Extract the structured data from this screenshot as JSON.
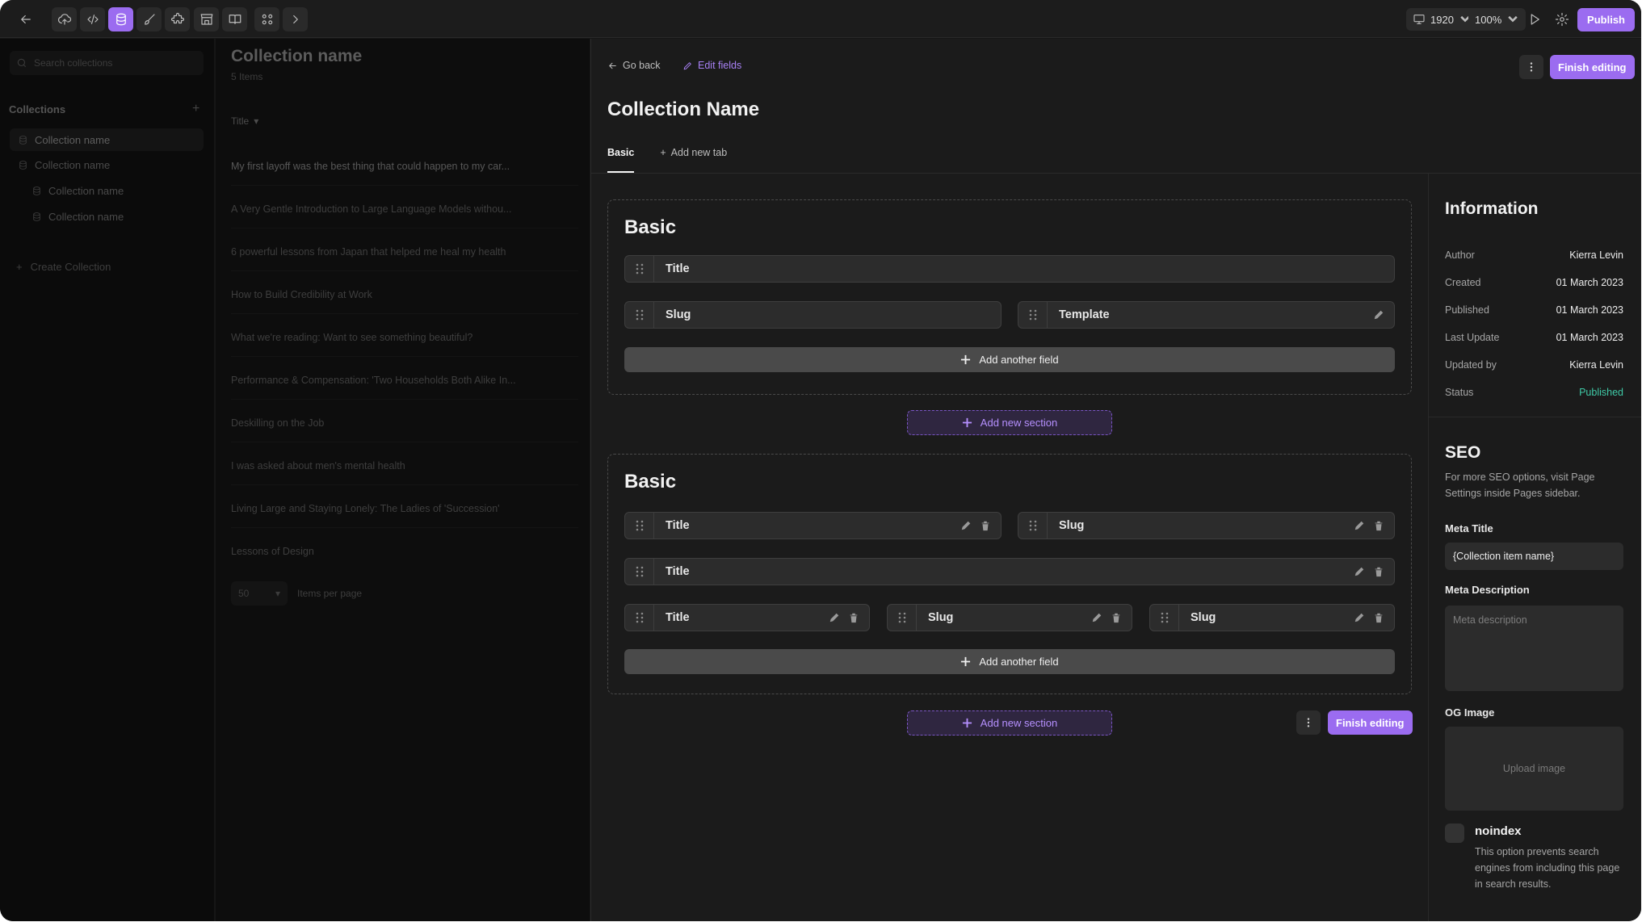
{
  "topbar": {
    "viewport_width": "1920",
    "zoom": "100%",
    "publish_label": "Publish"
  },
  "sidebar": {
    "search_placeholder": "Search collections",
    "heading": "Collections",
    "items": [
      {
        "label": "Collection name"
      },
      {
        "label": "Collection name"
      },
      {
        "label": "Collection name"
      },
      {
        "label": "Collection name"
      }
    ],
    "create_label": "Create Collection"
  },
  "list": {
    "title": "Collection name",
    "count": "5 Items",
    "sort_label": "Title",
    "rows": [
      "My first layoff was the best thing that could happen to my car...",
      "A Very Gentle Introduction to Large Language Models withou...",
      "6 powerful lessons from Japan that helped me heal my health",
      "How to Build Credibility at Work",
      "What we're reading: Want to see something beautiful?",
      "Performance & Compensation: 'Two Households Both Alike In...",
      "Deskilling on the Job",
      "I was asked about men's mental health",
      "Living Large and Staying Lonely: The Ladies of 'Succession'",
      "Lessons of Design"
    ],
    "per_page_value": "50",
    "per_page_label": "Items per page"
  },
  "panel": {
    "back_label": "Go back",
    "edit_label": "Edit fields",
    "title": "Collection Name",
    "finish_label": "Finish editing",
    "tabs": [
      {
        "label": "Basic"
      },
      {
        "label": "Add new tab"
      }
    ],
    "sections": [
      {
        "title": "Basic",
        "fields": [
          {
            "label": "Title"
          },
          {
            "label": "Slug"
          },
          {
            "label": "Template"
          }
        ],
        "add_field_label": "Add another field"
      },
      {
        "title": "Basic",
        "fields": [
          {
            "label": "Title"
          },
          {
            "label": "Slug"
          },
          {
            "label": "Title"
          },
          {
            "label": "Title"
          },
          {
            "label": "Slug"
          },
          {
            "label": "Slug"
          }
        ],
        "add_field_label": "Add another field"
      }
    ],
    "add_section_label": "Add new section"
  },
  "info": {
    "title": "Information",
    "rows": [
      {
        "key": "Author",
        "value": "Kierra Levin"
      },
      {
        "key": "Created",
        "value": "01 March 2023"
      },
      {
        "key": "Published",
        "value": "01 March 2023"
      },
      {
        "key": "Last Update",
        "value": "01 March 2023"
      },
      {
        "key": "Updated by",
        "value": "Kierra Levin"
      },
      {
        "key": "Status",
        "value": "Published"
      }
    ],
    "seo_title": "SEO",
    "seo_desc": "For more SEO options, visit Page Settings inside Pages sidebar.",
    "meta_title_label": "Meta Title",
    "meta_title_value": "{Collection item name}",
    "meta_desc_label": "Meta Description",
    "meta_desc_placeholder": "Meta description",
    "og_label": "OG Image",
    "upload_label": "Upload image",
    "noindex_label": "noindex",
    "noindex_desc": "This option prevents search engines from including this page in search results."
  },
  "colors": {
    "accent": "#9b6cf0",
    "status_published": "#3fc9a6"
  }
}
